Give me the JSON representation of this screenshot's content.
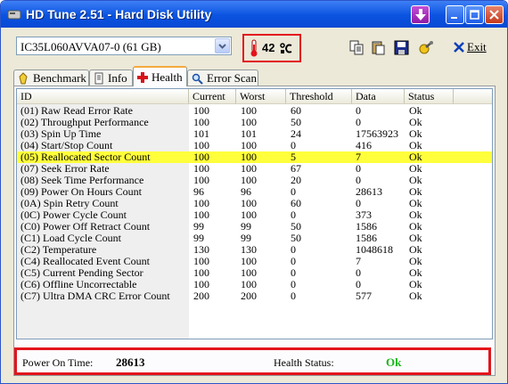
{
  "window": {
    "title": "HD Tune 2.51 - Hard Disk Utility"
  },
  "toolbar": {
    "drive_selected": "IC35L060AVVA07-0 (61 GB)",
    "temperature_value": "42",
    "temperature_icon": "thermometer-icon",
    "exit_label": "Exit"
  },
  "tabs": [
    {
      "label": "Benchmark",
      "icon": "benchmark-icon"
    },
    {
      "label": "Info",
      "icon": "info-icon"
    },
    {
      "label": "Health",
      "icon": "health-cross-icon",
      "active": true
    },
    {
      "label": "Error Scan",
      "icon": "magnifier-icon"
    }
  ],
  "table": {
    "columns": [
      "ID",
      "Current",
      "Worst",
      "Threshold",
      "Data",
      "Status"
    ],
    "rows": [
      {
        "id": "(01) Raw Read Error Rate",
        "current": "100",
        "worst": "100",
        "threshold": "60",
        "data": "0",
        "status": "Ok"
      },
      {
        "id": "(02) Throughput Performance",
        "current": "100",
        "worst": "100",
        "threshold": "50",
        "data": "0",
        "status": "Ok"
      },
      {
        "id": "(03) Spin Up Time",
        "current": "101",
        "worst": "101",
        "threshold": "24",
        "data": "17563923",
        "status": "Ok"
      },
      {
        "id": "(04) Start/Stop Count",
        "current": "100",
        "worst": "100",
        "threshold": "0",
        "data": "416",
        "status": "Ok"
      },
      {
        "id": "(05) Reallocated Sector Count",
        "current": "100",
        "worst": "100",
        "threshold": "5",
        "data": "7",
        "status": "Ok",
        "highlight": true
      },
      {
        "id": "(07) Seek Error Rate",
        "current": "100",
        "worst": "100",
        "threshold": "67",
        "data": "0",
        "status": "Ok"
      },
      {
        "id": "(08) Seek Time Performance",
        "current": "100",
        "worst": "100",
        "threshold": "20",
        "data": "0",
        "status": "Ok"
      },
      {
        "id": "(09) Power On Hours Count",
        "current": "96",
        "worst": "96",
        "threshold": "0",
        "data": "28613",
        "status": "Ok"
      },
      {
        "id": "(0A) Spin Retry Count",
        "current": "100",
        "worst": "100",
        "threshold": "60",
        "data": "0",
        "status": "Ok"
      },
      {
        "id": "(0C) Power Cycle Count",
        "current": "100",
        "worst": "100",
        "threshold": "0",
        "data": "373",
        "status": "Ok"
      },
      {
        "id": "(C0) Power Off Retract Count",
        "current": "99",
        "worst": "99",
        "threshold": "50",
        "data": "1586",
        "status": "Ok"
      },
      {
        "id": "(C1) Load Cycle Count",
        "current": "99",
        "worst": "99",
        "threshold": "50",
        "data": "1586",
        "status": "Ok"
      },
      {
        "id": "(C2) Temperature",
        "current": "130",
        "worst": "130",
        "threshold": "0",
        "data": "1048618",
        "status": "Ok"
      },
      {
        "id": "(C4) Reallocated Event Count",
        "current": "100",
        "worst": "100",
        "threshold": "0",
        "data": "7",
        "status": "Ok"
      },
      {
        "id": "(C5) Current Pending Sector",
        "current": "100",
        "worst": "100",
        "threshold": "0",
        "data": "0",
        "status": "Ok"
      },
      {
        "id": "(C6) Offline Uncorrectable",
        "current": "100",
        "worst": "100",
        "threshold": "0",
        "data": "0",
        "status": "Ok"
      },
      {
        "id": "(C7) Ultra DMA CRC Error Count",
        "current": "200",
        "worst": "200",
        "threshold": "0",
        "data": "577",
        "status": "Ok"
      }
    ]
  },
  "footer": {
    "power_on_label": "Power On Time:",
    "power_on_value": "28613",
    "health_label": "Health Status:",
    "health_value": "Ok",
    "health_color": "#1bb51b"
  },
  "colors": {
    "highlight_row": "#ffff3c",
    "callout_border": "#e3141c",
    "titlebar": "#0a53e0"
  }
}
